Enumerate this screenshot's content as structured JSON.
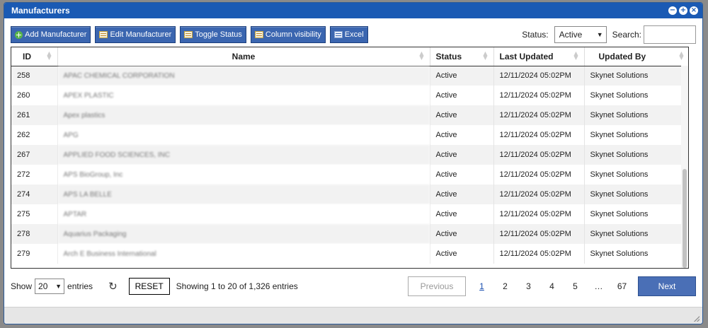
{
  "window": {
    "title": "Manufacturers",
    "controls": [
      "−",
      "+",
      "×"
    ]
  },
  "toolbar": {
    "add_label": "Add Manufacturer",
    "edit_label": "Edit Manufacturer",
    "toggle_label": "Toggle Status",
    "columns_label": "Column visibility",
    "excel_label": "Excel",
    "status_label": "Status:",
    "status_value": "Active",
    "search_label": "Search:",
    "search_value": ""
  },
  "table": {
    "columns": [
      "ID",
      "Name",
      "Status",
      "Last Updated",
      "Updated By"
    ],
    "rows": [
      {
        "id": "258",
        "name": "APAC CHEMICAL CORPORATION",
        "status": "Active",
        "updated": "12/11/2024 05:02PM",
        "by": "Skynet Solutions"
      },
      {
        "id": "260",
        "name": "APEX PLASTIC",
        "status": "Active",
        "updated": "12/11/2024 05:02PM",
        "by": "Skynet Solutions"
      },
      {
        "id": "261",
        "name": "Apex plastics",
        "status": "Active",
        "updated": "12/11/2024 05:02PM",
        "by": "Skynet Solutions"
      },
      {
        "id": "262",
        "name": "APG",
        "status": "Active",
        "updated": "12/11/2024 05:02PM",
        "by": "Skynet Solutions"
      },
      {
        "id": "267",
        "name": "APPLIED FOOD SCIENCES, INC",
        "status": "Active",
        "updated": "12/11/2024 05:02PM",
        "by": "Skynet Solutions"
      },
      {
        "id": "272",
        "name": "APS BioGroup, Inc",
        "status": "Active",
        "updated": "12/11/2024 05:02PM",
        "by": "Skynet Solutions"
      },
      {
        "id": "274",
        "name": "APS LA BELLE",
        "status": "Active",
        "updated": "12/11/2024 05:02PM",
        "by": "Skynet Solutions"
      },
      {
        "id": "275",
        "name": "APTAR",
        "status": "Active",
        "updated": "12/11/2024 05:02PM",
        "by": "Skynet Solutions"
      },
      {
        "id": "278",
        "name": "Aquarius Packaging",
        "status": "Active",
        "updated": "12/11/2024 05:02PM",
        "by": "Skynet Solutions"
      },
      {
        "id": "279",
        "name": "Arch E Business International",
        "status": "Active",
        "updated": "12/11/2024 05:02PM",
        "by": "Skynet Solutions"
      }
    ]
  },
  "footer": {
    "show_label": "Show",
    "entries_value": "20",
    "entries_label": "entries",
    "reset_label": "RESET",
    "info": "Showing 1 to 20 of 1,326 entries",
    "prev_label": "Previous",
    "next_label": "Next",
    "pages": [
      "1",
      "2",
      "3",
      "4",
      "5",
      "…",
      "67"
    ]
  }
}
